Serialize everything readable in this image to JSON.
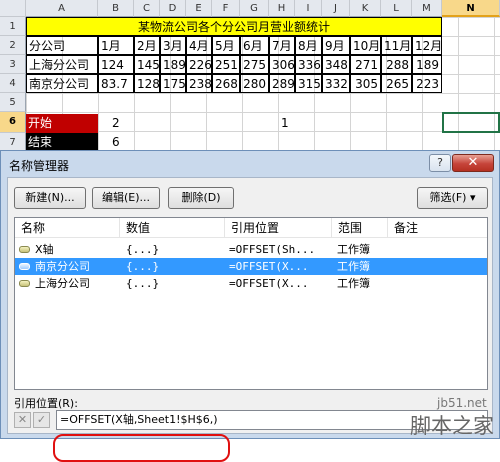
{
  "sheet": {
    "columns": [
      "A",
      "B",
      "C",
      "D",
      "E",
      "F",
      "G",
      "H",
      "I",
      "J",
      "K",
      "L",
      "M",
      "N"
    ],
    "rows": [
      "1",
      "2",
      "3",
      "4",
      "5",
      "6",
      "7"
    ],
    "title": "某物流公司各个分公司月营业额统计",
    "header_row": {
      "label": "分公司",
      "months": [
        "1月",
        "2月",
        "3月",
        "4月",
        "5月",
        "6月",
        "7月",
        "8月",
        "9月",
        "10月",
        "11月",
        "12月"
      ]
    },
    "data_rows": [
      {
        "label": "上海分公司",
        "values": [
          "124",
          "145",
          "189",
          "226",
          "251",
          "275",
          "306",
          "336",
          "348",
          "271",
          "288",
          "189"
        ]
      },
      {
        "label": "南京分公司",
        "values": [
          "83.7",
          "128",
          "175",
          "238",
          "268",
          "280",
          "289",
          "315",
          "332",
          "305",
          "265",
          "223"
        ]
      }
    ],
    "start": {
      "label": "开始",
      "value_b": "2",
      "value_h": "1"
    },
    "end": {
      "label": "结束",
      "value_b": "6"
    },
    "colors": {
      "title_fill": "#ffff00",
      "start_fill": "#c00000",
      "end_fill": "#000000",
      "selection": "#217346"
    }
  },
  "dialog": {
    "title": "名称管理器",
    "help_label": "?",
    "close_label": "✕",
    "new_button": "新建(N)...",
    "edit_button": "编辑(E)...",
    "delete_button": "删除(D)",
    "filter_button": "筛选(F) ▾",
    "list_headers": {
      "name": "名称",
      "value": "数值",
      "refers_to": "引用位置",
      "scope": "范围",
      "comment": "备注"
    },
    "names": [
      {
        "name": "X轴",
        "value": "{...}",
        "refers_to": "=OFFSET(Sh...",
        "scope": "工作簿",
        "selected": false
      },
      {
        "name": "南京分公司",
        "value": "{...}",
        "refers_to": "=OFFSET(X...",
        "scope": "工作簿",
        "selected": true
      },
      {
        "name": "上海分公司",
        "value": "{...}",
        "refers_to": "=OFFSET(X...",
        "scope": "工作簿",
        "selected": false
      }
    ],
    "refers_to_label": "引用位置(R):",
    "refers_to_value": "=OFFSET(X轴,Sheet1!$H$6,)",
    "cancel_icon": "✕",
    "confirm_icon": "✓"
  },
  "watermark": {
    "line1": "jb51.net",
    "line2": "脚本之家"
  }
}
